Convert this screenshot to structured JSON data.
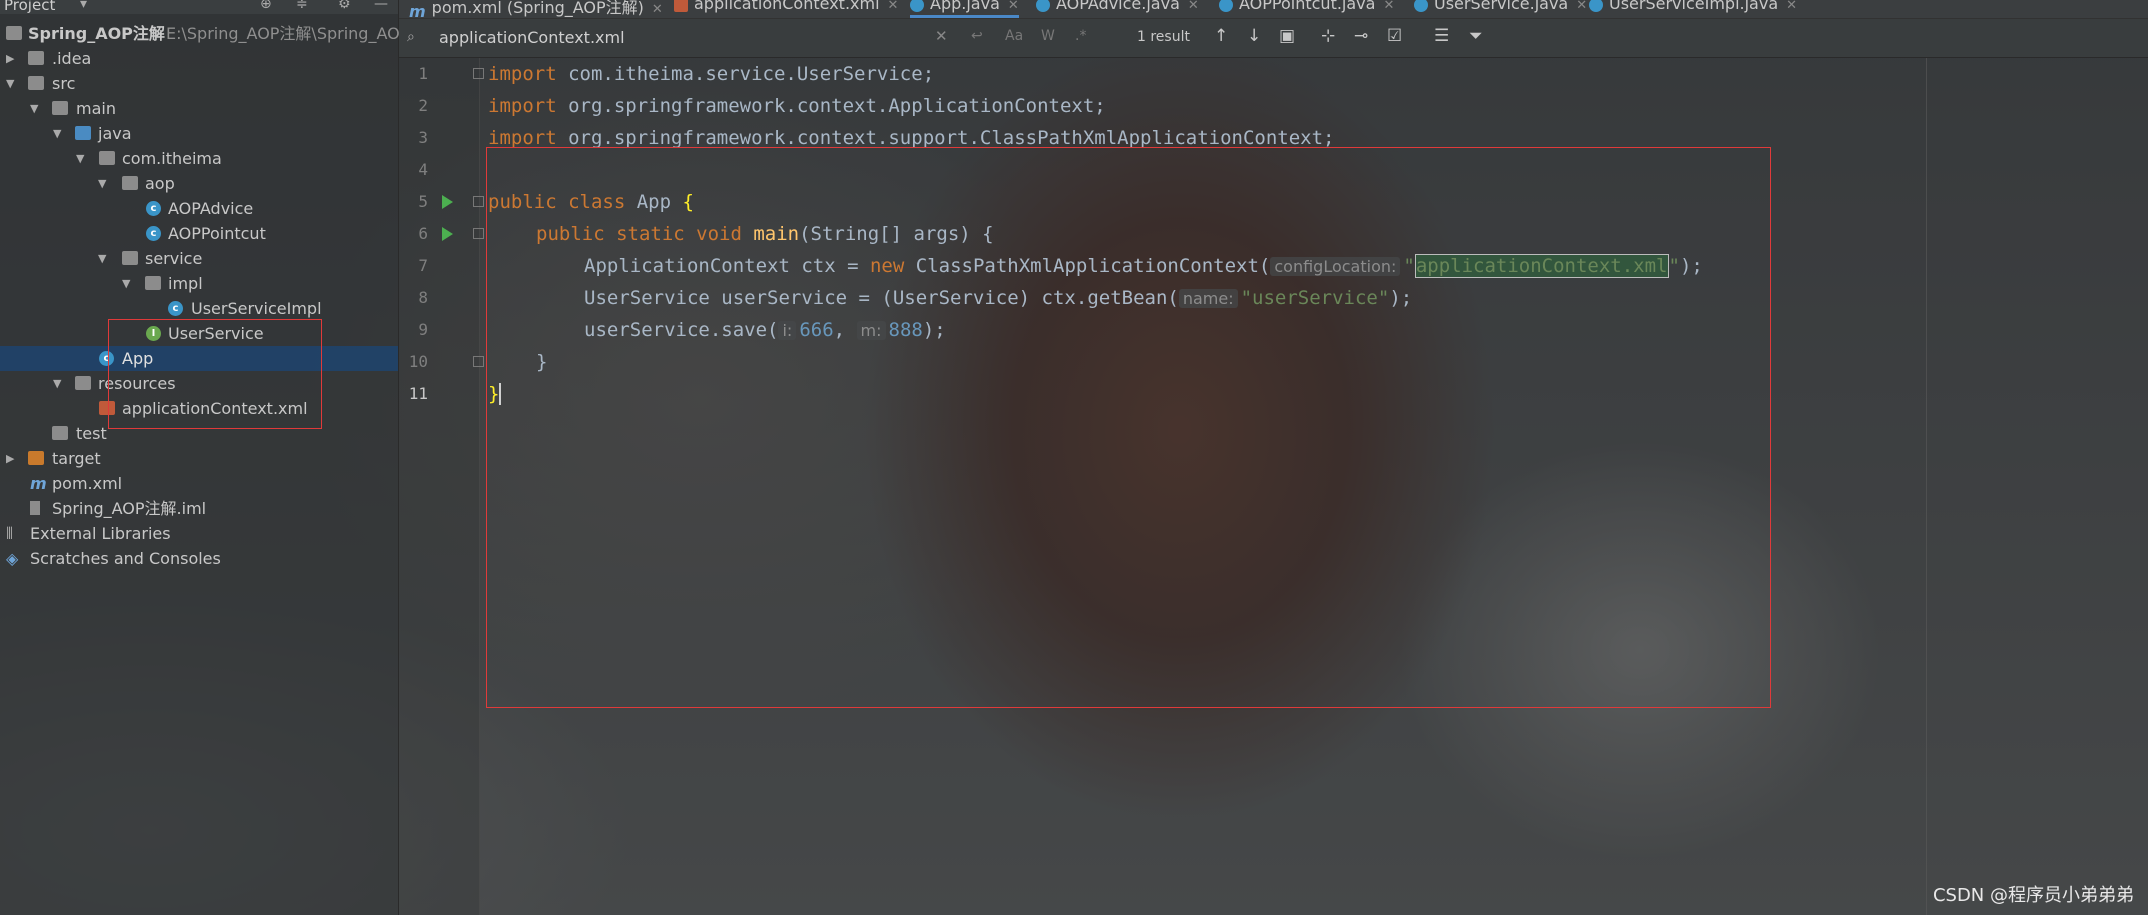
{
  "project_panel": {
    "header_label": "Project",
    "items": [
      {
        "label": "Spring_AOP注解",
        "path": "E:\\Spring_AOP注解\\Spring_AO"
      },
      {
        "label": ".idea"
      },
      {
        "label": "src"
      },
      {
        "label": "main"
      },
      {
        "label": "java"
      },
      {
        "label": "com.itheima"
      },
      {
        "label": "aop"
      },
      {
        "label": "AOPAdvice"
      },
      {
        "label": "AOPPointcut"
      },
      {
        "label": "service"
      },
      {
        "label": "impl"
      },
      {
        "label": "UserServiceImpl"
      },
      {
        "label": "UserService"
      },
      {
        "label": "App"
      },
      {
        "label": "resources"
      },
      {
        "label": "applicationContext.xml"
      },
      {
        "label": "test"
      },
      {
        "label": "target"
      },
      {
        "label": "pom.xml"
      },
      {
        "label": "Spring_AOP注解.iml"
      },
      {
        "label": "External Libraries"
      },
      {
        "label": "Scratches and Consoles"
      }
    ]
  },
  "tabs": [
    {
      "label": "pom.xml (Spring_AOP注解)"
    },
    {
      "label": "applicationContext.xml"
    },
    {
      "label": "App.java",
      "active": true
    },
    {
      "label": "AOPAdvice.java"
    },
    {
      "label": "AOPPointcut.java"
    },
    {
      "label": "UserService.java"
    },
    {
      "label": "UserServiceImpl.java"
    }
  ],
  "search": {
    "query": "applicationContext.xml",
    "match_case": "Aa",
    "words": "W",
    "regex": ".*",
    "result_count": "1 result"
  },
  "editor": {
    "line_numbers": [
      "1",
      "2",
      "3",
      "4",
      "5",
      "6",
      "7",
      "8",
      "9",
      "10",
      "11"
    ],
    "lines": {
      "l1_kw": "import",
      "l1_rest": " com.itheima.service.UserService;",
      "l2_kw": "import",
      "l2_rest": " org.springframework.context.ApplicationContext;",
      "l3_kw": "import",
      "l3_rest": " org.springframework.context.support.ClassPathXmlApplicationContext;",
      "l5_kw": "public class",
      "l5_name": " App ",
      "l5_brace": "{",
      "l6_kw": "public static void",
      "l6_fn": " main",
      "l6_rest": "(String[] args) {",
      "l7_a": "ApplicationContext ctx = ",
      "l7_new": "new",
      "l7_b": " ClassPathXmlApplicationContext(",
      "l7_hint": "configLocation:",
      "l7_q1": "\"",
      "l7_str": "applicationContext.xml",
      "l7_q2": "\"",
      "l7_end": ");",
      "l8_a": "UserService userService = (UserService) ctx.getBean(",
      "l8_hint": "name:",
      "l8_str": "\"userService\"",
      "l8_end": ");",
      "l9_a": "userService.save(",
      "l9_hint1": "i:",
      "l9_num1": "666",
      "l9_comma": ", ",
      "l9_hint2": "m:",
      "l9_num2": "888",
      "l9_end": ");",
      "l10": "}",
      "l11": "}"
    }
  },
  "watermark": "CSDN @程序员小弟弟弟",
  "colors": {
    "keyword": "#cc7832",
    "string": "#6a8759",
    "number": "#6897bb",
    "method": "#ffc66d",
    "annotation_box": "#e03a3a",
    "selection": "#214268"
  }
}
